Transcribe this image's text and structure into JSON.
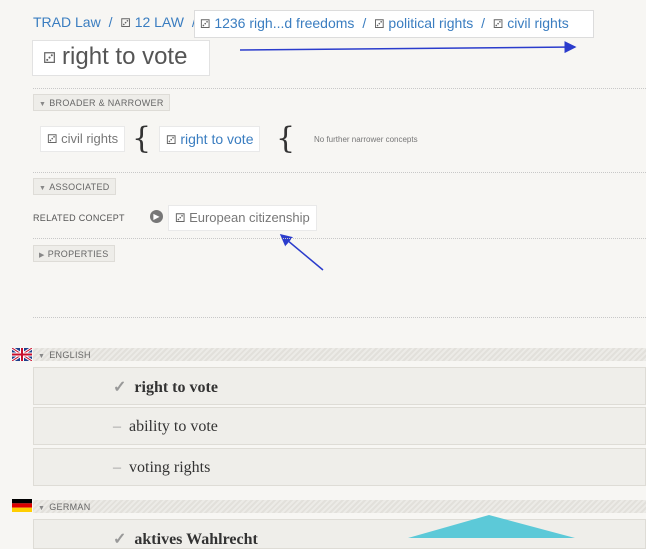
{
  "breadcrumb": {
    "items": [
      "TRAD Law",
      "12 LAW",
      "1236 righ...d freedoms",
      "political rights",
      "civil rights"
    ]
  },
  "title": "right to vote",
  "sections": {
    "broader_narrower": "BROADER & NARROWER",
    "associated": "ASSOCIATED",
    "properties": "PROPERTIES"
  },
  "broader_narrower": {
    "broader": "civil rights",
    "current": "right to vote",
    "narrower_note": "No further narrower concepts"
  },
  "associated": {
    "relation_label": "RELATED CONCEPT",
    "related": "European citizenship"
  },
  "languages": [
    {
      "name": "ENGLISH",
      "terms": [
        {
          "mark": "✓",
          "text": "right to vote"
        },
        {
          "mark": "–",
          "text": "ability to vote"
        },
        {
          "mark": "–",
          "text": "voting rights"
        }
      ]
    },
    {
      "name": "GERMAN",
      "terms": [
        {
          "mark": "✓",
          "text": "aktives Wahlrecht"
        }
      ]
    }
  ],
  "icons": {
    "concept": "concept-node-icon",
    "goto": "arrow-circle-icon",
    "uk_flag": "uk-flag-icon",
    "de_flag": "germany-flag-icon"
  },
  "colors": {
    "link": "#3a7dc0",
    "annotation_arrow": "#2b3ccc",
    "overlay_shape": "#5cc9d8"
  }
}
